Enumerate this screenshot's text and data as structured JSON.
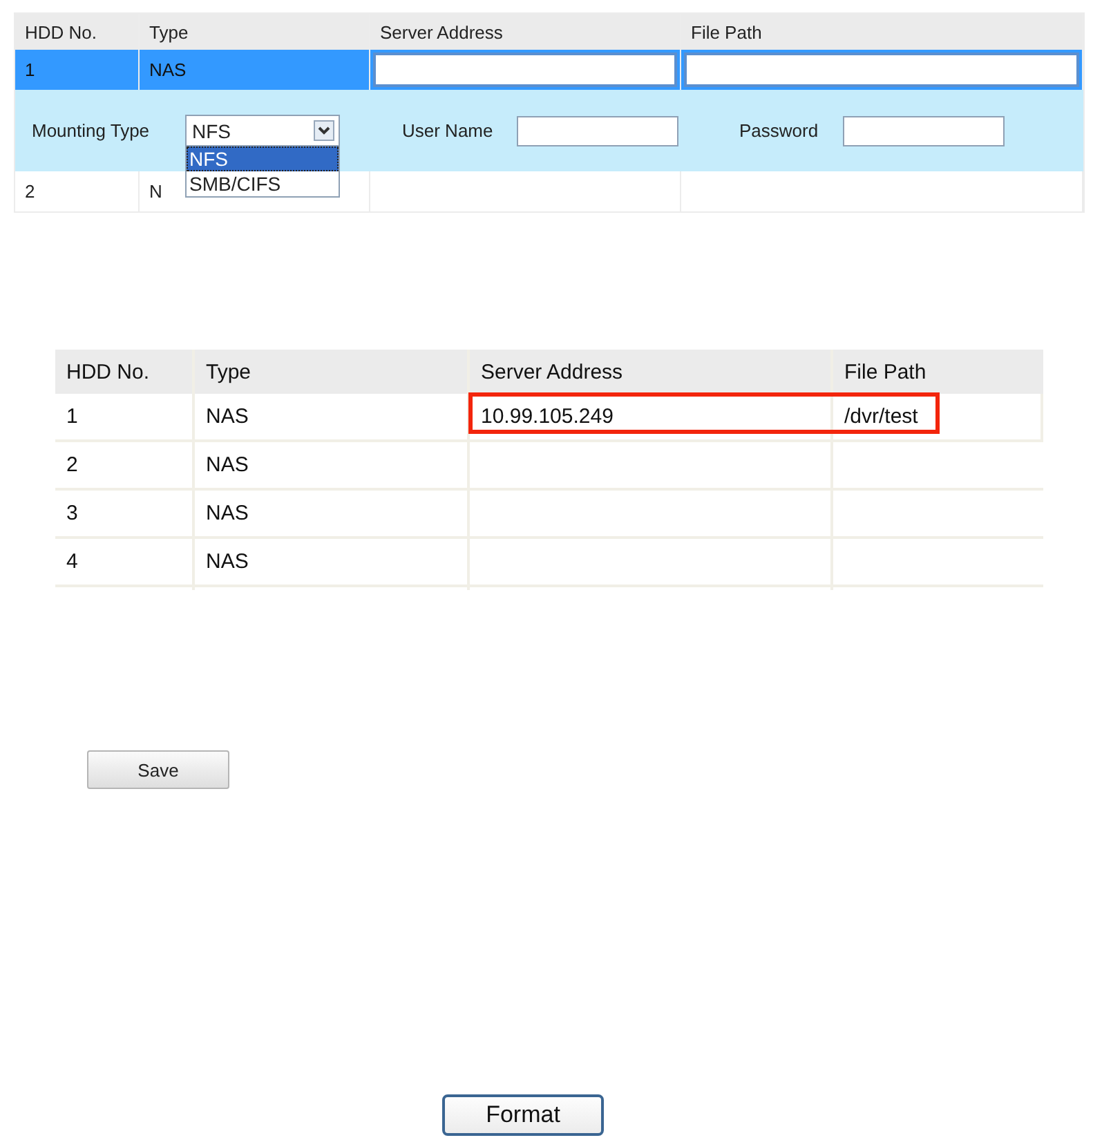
{
  "top_table": {
    "columns": [
      "HDD No.",
      "Type",
      "Server Address",
      "File Path"
    ],
    "rows": [
      {
        "hdd_no": "1",
        "type": "NAS",
        "selected": true
      },
      {
        "hdd_no": "2",
        "type": "N",
        "selected": false
      }
    ],
    "mounting_panel": {
      "mounting_type_label": "Mounting Type",
      "mounting_type_value": "NFS",
      "dropdown_open": true,
      "options": [
        {
          "label": "NFS",
          "selected": true
        },
        {
          "label": "SMB/CIFS",
          "selected": false
        }
      ],
      "user_name_label": "User Name",
      "password_label": "Password"
    }
  },
  "hdd_table": {
    "columns": [
      "HDD No.",
      "Type",
      "Server Address",
      "File Path"
    ],
    "rows": [
      {
        "hdd_no": "1",
        "type": "NAS",
        "server_address": "10.99.105.249",
        "file_path": "/dvr/test",
        "highlighted": true
      },
      {
        "hdd_no": "2",
        "type": "NAS",
        "highlighted": false
      },
      {
        "hdd_no": "3",
        "type": "NAS",
        "highlighted": false
      },
      {
        "hdd_no": "4",
        "type": "NAS",
        "highlighted": false
      }
    ]
  },
  "save_button": "Save",
  "format_button": "Format"
}
